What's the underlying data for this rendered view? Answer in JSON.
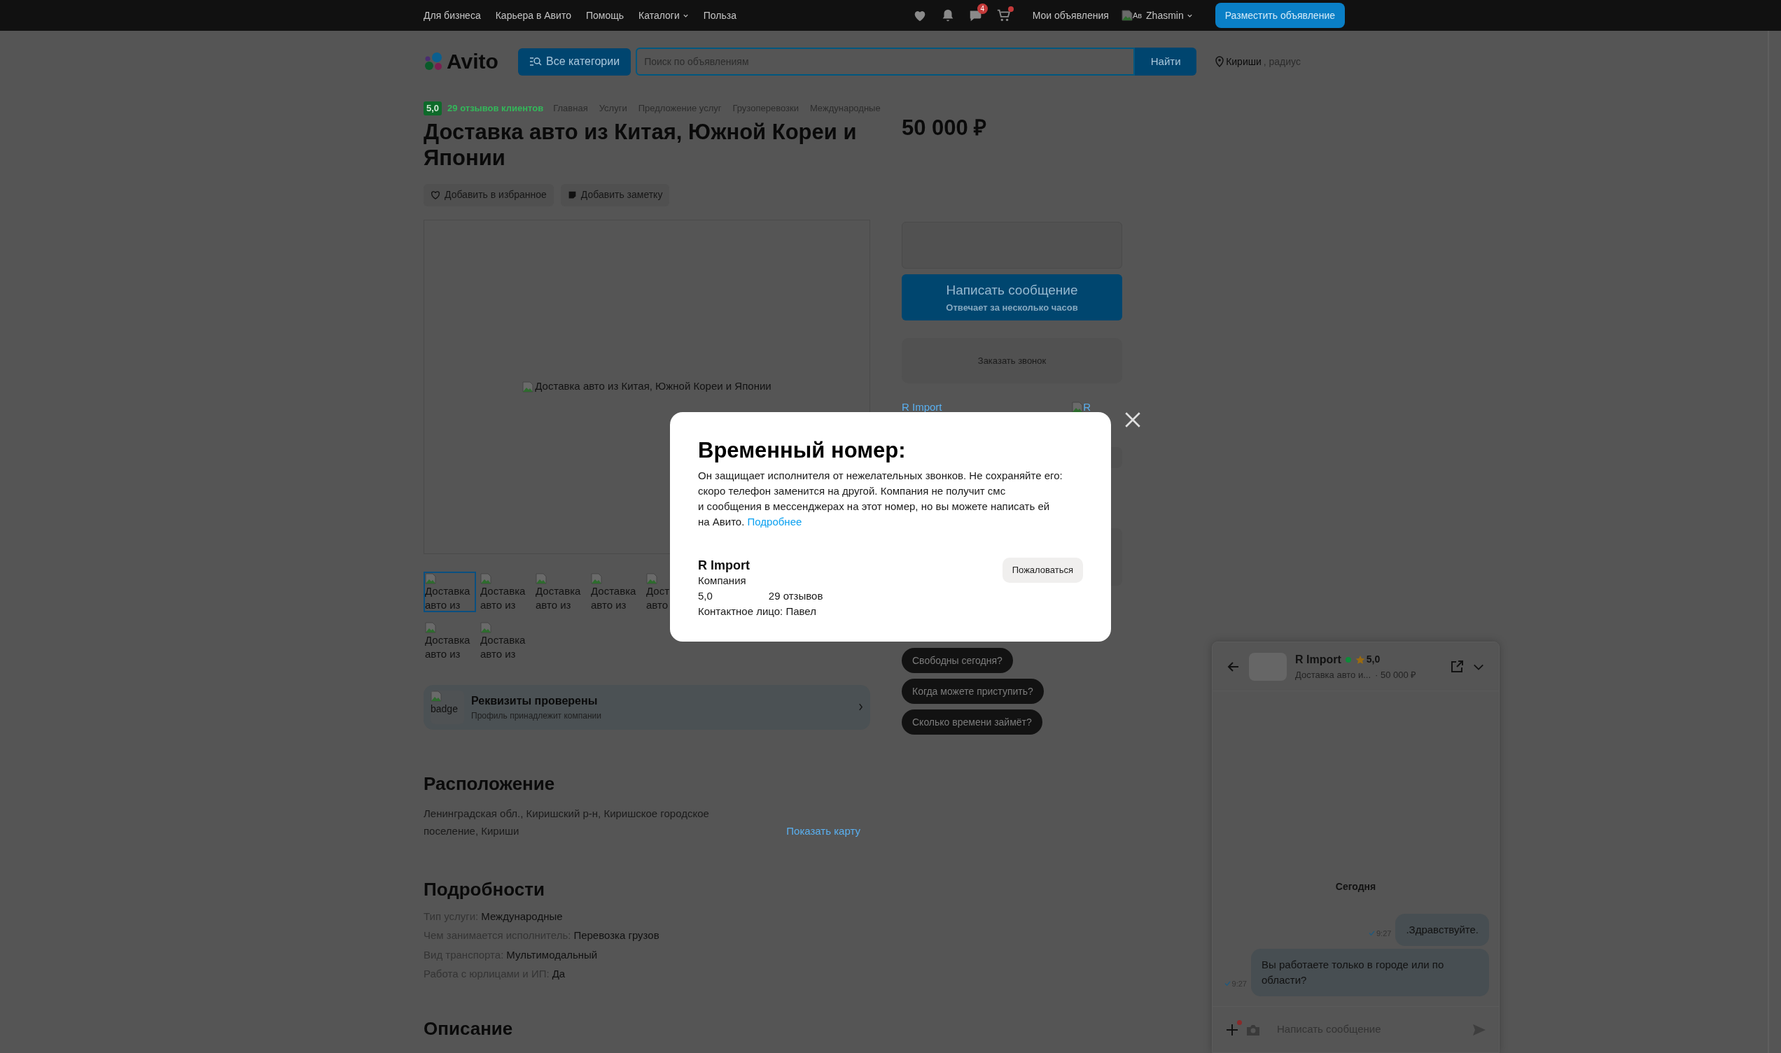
{
  "top_bar": {
    "links": [
      {
        "label": "Для бизнеса",
        "kind": "link"
      },
      {
        "label": "Карьера в Авито",
        "kind": "link"
      },
      {
        "label": "Помощь",
        "kind": "link"
      },
      {
        "label": "Каталоги",
        "kind": "dropdown"
      },
      {
        "label": "Польза",
        "kind": "link"
      }
    ],
    "messages_badge": "4",
    "cart_dot": true,
    "my_ads": "Мои объявления",
    "avatar_alt": "Ав",
    "user_name": "Zhasmin",
    "post_button": "Разместить объявление"
  },
  "header": {
    "logo": "Avito",
    "categories_button": "Все категории",
    "search": {
      "placeholder": "Поиск по объявлениям"
    },
    "search_button": "Найти",
    "location": "Кириши",
    "location_suffix": ", радиус"
  },
  "listing": {
    "rating_badge": "5,0",
    "reviews_link": "29 отзывов клиентов",
    "breadcrumbs": [
      "Главная",
      "Услуги",
      "Предложение услуг",
      "Грузоперевозки",
      "Международные"
    ],
    "title": "Доставка авто из Китая, Южной Кореи и Японии",
    "price": "50 000 ₽",
    "actions": [
      {
        "label": "Добавить в избранное",
        "kind": "favorite"
      },
      {
        "label": "Добавить заметку",
        "kind": "note"
      }
    ],
    "gallery_alt": "Доставка авто из Китая, Южной Кореи и Японии",
    "thumbnails": [
      {
        "alt": "Доставка авто из",
        "selected": true
      },
      {
        "alt": "Доставка авто из",
        "selected": false
      },
      {
        "alt": "Доставка авто из",
        "selected": false
      },
      {
        "alt": "Доставка авто из",
        "selected": false
      },
      {
        "alt": "Дост авто",
        "selected": false
      },
      {
        "alt": "Доставка авто из",
        "selected": false
      },
      {
        "alt": "Доставка авто из",
        "selected": false
      }
    ],
    "requisites": {
      "badge_alt": "badge",
      "title": "Реквизиты проверены",
      "subtitle": "Профиль принадлежит компании"
    },
    "location": {
      "heading": "Расположение",
      "address": "Ленинградская обл., Киришский р-н, Киришское городское поселение, Кириши",
      "map_link": "Показать карту"
    },
    "details": {
      "heading": "Подробности",
      "rows": [
        {
          "label": "Тип услуги:",
          "value": "Международные"
        },
        {
          "label": "Чем занимается исполнитель:",
          "value": "Перевозка грузов"
        },
        {
          "label": "Вид транспорта:",
          "value": "Мультимодальный"
        },
        {
          "label": "Работа с юрлицами и ИП:",
          "value": "Да"
        }
      ]
    },
    "description_heading": "Описание"
  },
  "contact": {
    "message_button": "Написать сообщение",
    "message_hint": "Отвечает за несколько часов",
    "call_button": "Заказать звонок",
    "seller_link": "R Import",
    "seller_avatar_alt": "R"
  },
  "quick_replies": [
    "Свободны сегодня?",
    "Когда можете приступить?",
    "Сколько времени займёт?"
  ],
  "modal": {
    "title": "Временный номер:",
    "text": "Он защищает исполнителя от нежелательных звонков. Не сохраняйте его:\nскоро телефон заменится на другой. Компания не получит смс\nи сообщения в мессенджерах на этот номер, но вы можете написать ей\nна Авито.",
    "link": "Подробнее",
    "company": "R Import",
    "company_type": "Компания",
    "rating": "5,0",
    "reviews": "29 отзывов",
    "contact": "Контактное лицо: Павел",
    "report_button": "Пожаловаться"
  },
  "chat": {
    "name": "R Import",
    "online": true,
    "rating": "5,0",
    "item": "Доставка авто и...",
    "price": "· 50 000 ₽",
    "day": "Сегодня",
    "messages": [
      {
        "text": ".Здравствуйте.",
        "time": "9:27"
      },
      {
        "text": "Вы работаете только в городе или по области?",
        "time": "9:27"
      }
    ],
    "input": {
      "placeholder": "Написать сообщение"
    },
    "attach_dot": true
  }
}
